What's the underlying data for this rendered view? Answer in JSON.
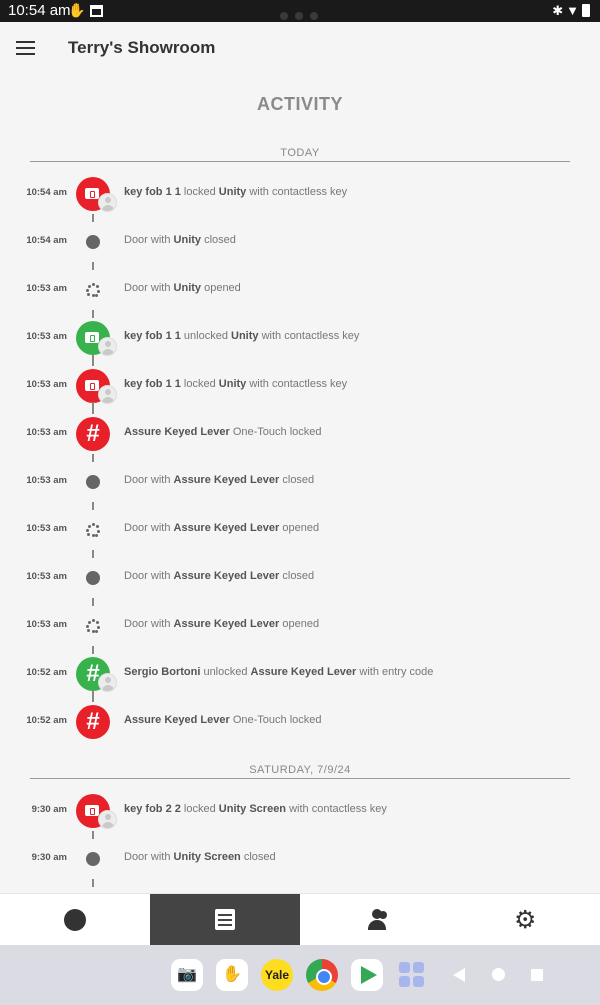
{
  "status_bar": {
    "time": "10:54 am"
  },
  "header": {
    "title": "Terry's Showroom"
  },
  "page_heading": "ACTIVITY",
  "sections": [
    {
      "label": "TODAY",
      "rows": [
        {
          "time": "10:54 am",
          "icon": "red-keyfob-icon",
          "parts": [
            [
              "b",
              "key fob 1 1"
            ],
            [
              "n",
              " locked "
            ],
            [
              "b",
              "Unity"
            ],
            [
              "n",
              " with contactless key"
            ]
          ]
        },
        {
          "time": "10:54 am",
          "icon": "door-closed-icon",
          "parts": [
            [
              "n",
              "Door with "
            ],
            [
              "b",
              "Unity"
            ],
            [
              "n",
              " closed"
            ]
          ]
        },
        {
          "time": "10:53 am",
          "icon": "door-opened-icon",
          "parts": [
            [
              "n",
              "Door with "
            ],
            [
              "b",
              "Unity"
            ],
            [
              "n",
              " opened"
            ]
          ]
        },
        {
          "time": "10:53 am",
          "icon": "green-keyfob-icon",
          "parts": [
            [
              "b",
              "key fob 1 1"
            ],
            [
              "n",
              " unlocked "
            ],
            [
              "b",
              "Unity"
            ],
            [
              "n",
              " with contactless key"
            ]
          ]
        },
        {
          "time": "10:53 am",
          "icon": "red-keyfob-icon",
          "parts": [
            [
              "b",
              "key fob 1 1"
            ],
            [
              "n",
              " locked "
            ],
            [
              "b",
              "Unity"
            ],
            [
              "n",
              " with contactless key"
            ]
          ]
        },
        {
          "time": "10:53 am",
          "icon": "red-keypad-icon",
          "parts": [
            [
              "b",
              "Assure Keyed Lever"
            ],
            [
              "n",
              " One-Touch locked"
            ]
          ]
        },
        {
          "time": "10:53 am",
          "icon": "door-closed-icon",
          "parts": [
            [
              "n",
              "Door with "
            ],
            [
              "b",
              "Assure Keyed Lever"
            ],
            [
              "n",
              " closed"
            ]
          ]
        },
        {
          "time": "10:53 am",
          "icon": "door-opened-icon",
          "parts": [
            [
              "n",
              "Door with "
            ],
            [
              "b",
              "Assure Keyed Lever"
            ],
            [
              "n",
              " opened"
            ]
          ]
        },
        {
          "time": "10:53 am",
          "icon": "door-closed-icon",
          "parts": [
            [
              "n",
              "Door with "
            ],
            [
              "b",
              "Assure Keyed Lever"
            ],
            [
              "n",
              " closed"
            ]
          ]
        },
        {
          "time": "10:53 am",
          "icon": "door-opened-icon",
          "parts": [
            [
              "n",
              "Door with "
            ],
            [
              "b",
              "Assure Keyed Lever"
            ],
            [
              "n",
              " opened"
            ]
          ]
        },
        {
          "time": "10:52 am",
          "icon": "green-keypad-icon",
          "parts": [
            [
              "b",
              "Sergio Bortoni"
            ],
            [
              "n",
              " unlocked "
            ],
            [
              "b",
              "Assure Keyed Lever"
            ],
            [
              "n",
              " with entry code"
            ]
          ]
        },
        {
          "time": "10:52 am",
          "icon": "red-keypad-icon",
          "parts": [
            [
              "b",
              "Assure Keyed Lever"
            ],
            [
              "n",
              " One-Touch locked"
            ]
          ]
        }
      ]
    },
    {
      "label": "SATURDAY, 7/9/24",
      "rows": [
        {
          "time": "9:30 am",
          "icon": "red-keyfob-icon",
          "parts": [
            [
              "b",
              "key fob 2 2"
            ],
            [
              "n",
              " locked "
            ],
            [
              "b",
              "Unity Screen"
            ],
            [
              "n",
              " with contactless key"
            ]
          ]
        },
        {
          "time": "9:30 am",
          "icon": "door-closed-icon",
          "parts": [
            [
              "n",
              "Door with "
            ],
            [
              "b",
              "Unity Screen"
            ],
            [
              "n",
              " closed"
            ]
          ]
        }
      ]
    }
  ],
  "bottom_nav": {
    "active": "activity"
  },
  "dock": {
    "yale_label": "Yale"
  }
}
